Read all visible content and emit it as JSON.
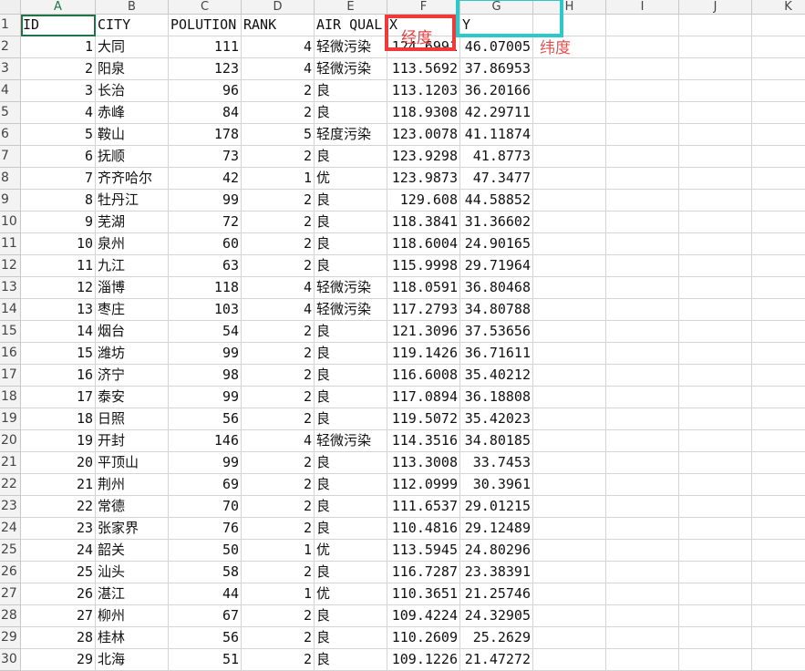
{
  "columns": [
    "A",
    "B",
    "C",
    "D",
    "E",
    "F",
    "G",
    "H",
    "I",
    "J",
    "K"
  ],
  "header_row": [
    "ID",
    "CITY",
    "POLUTION",
    "RANK",
    "AIR QUAL",
    "X",
    "Y"
  ],
  "rows": [
    [
      "1",
      "大同",
      "111",
      "4",
      "轻微污染",
      "124.6991",
      "46.07005"
    ],
    [
      "2",
      "阳泉",
      "123",
      "4",
      "轻微污染",
      "113.5692",
      "37.86953"
    ],
    [
      "3",
      "长治",
      "96",
      "2",
      "良",
      "113.1203",
      "36.20166"
    ],
    [
      "4",
      "赤峰",
      "84",
      "2",
      "良",
      "118.9308",
      "42.29711"
    ],
    [
      "5",
      "鞍山",
      "178",
      "5",
      "轻度污染",
      "123.0078",
      "41.11874"
    ],
    [
      "6",
      "抚顺",
      "73",
      "2",
      "良",
      "123.9298",
      "41.8773"
    ],
    [
      "7",
      "齐齐哈尔",
      "42",
      "1",
      "优",
      "123.9873",
      "47.3477"
    ],
    [
      "8",
      "牡丹江",
      "99",
      "2",
      "良",
      "129.608",
      "44.58852"
    ],
    [
      "9",
      "芜湖",
      "72",
      "2",
      "良",
      "118.3841",
      "31.36602"
    ],
    [
      "10",
      "泉州",
      "60",
      "2",
      "良",
      "118.6004",
      "24.90165"
    ],
    [
      "11",
      "九江",
      "63",
      "2",
      "良",
      "115.9998",
      "29.71964"
    ],
    [
      "12",
      "淄博",
      "118",
      "4",
      "轻微污染",
      "118.0591",
      "36.80468"
    ],
    [
      "13",
      "枣庄",
      "103",
      "4",
      "轻微污染",
      "117.2793",
      "34.80788"
    ],
    [
      "14",
      "烟台",
      "54",
      "2",
      "良",
      "121.3096",
      "37.53656"
    ],
    [
      "15",
      "潍坊",
      "99",
      "2",
      "良",
      "119.1426",
      "36.71611"
    ],
    [
      "16",
      "济宁",
      "98",
      "2",
      "良",
      "116.6008",
      "35.40212"
    ],
    [
      "17",
      "泰安",
      "99",
      "2",
      "良",
      "117.0894",
      "36.18808"
    ],
    [
      "18",
      "日照",
      "56",
      "2",
      "良",
      "119.5072",
      "35.42023"
    ],
    [
      "19",
      "开封",
      "146",
      "4",
      "轻微污染",
      "114.3516",
      "34.80185"
    ],
    [
      "20",
      "平顶山",
      "99",
      "2",
      "良",
      "113.3008",
      "33.7453"
    ],
    [
      "21",
      "荆州",
      "69",
      "2",
      "良",
      "112.0999",
      "30.3961"
    ],
    [
      "22",
      "常德",
      "70",
      "2",
      "良",
      "111.6537",
      "29.01215"
    ],
    [
      "23",
      "张家界",
      "76",
      "2",
      "良",
      "110.4816",
      "29.12489"
    ],
    [
      "24",
      "韶关",
      "50",
      "1",
      "优",
      "113.5945",
      "24.80296"
    ],
    [
      "25",
      "汕头",
      "58",
      "2",
      "良",
      "116.7287",
      "23.38391"
    ],
    [
      "26",
      "湛江",
      "44",
      "1",
      "优",
      "110.3651",
      "21.25746"
    ],
    [
      "27",
      "柳州",
      "67",
      "2",
      "良",
      "109.4224",
      "24.32905"
    ],
    [
      "28",
      "桂林",
      "56",
      "2",
      "良",
      "110.2609",
      "25.2629"
    ],
    [
      "29",
      "北海",
      "51",
      "2",
      "良",
      "109.1226",
      "21.47272"
    ]
  ],
  "annotations": {
    "longitude_label": "经度",
    "latitude_label": "纬度",
    "longitude_color": "#f03a3a",
    "latitude_color": "#2cc9c9"
  }
}
